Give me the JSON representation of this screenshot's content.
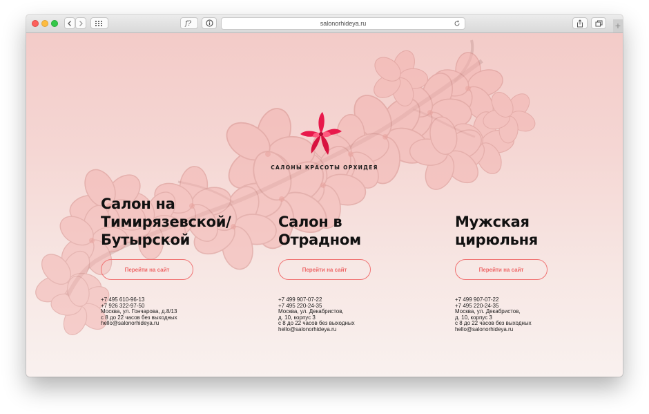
{
  "browser": {
    "url": "salonorhideya.ru",
    "new_tab": "+"
  },
  "brand": {
    "name": "САЛОНЫ КРАСОТЫ ОРХИДЕЯ",
    "accent_color": "#ee6767",
    "logo_icon": "orchid-logo-icon"
  },
  "salons": [
    {
      "title_lines": [
        "Салон на",
        "Тимирязевской/",
        "Бутырской"
      ],
      "button": "Перейти на сайт",
      "info": [
        "+7 495 610-96-13",
        "+7 926 322-97-50",
        "Москва, ул. Гончарова, д.8/13",
        "с 8 до 22 часов без выходных",
        "hello@salonorhideya.ru"
      ]
    },
    {
      "title_lines": [
        "Салон в",
        "Отрадном"
      ],
      "button": "Перейти на сайт",
      "info": [
        "+7 499 907-07-22",
        "+7 495 220-24-35",
        "Москва, ул. Декабристов,",
        "д. 10, корпус 3",
        "с 8 до 22 часов без выходных",
        "hello@salonorhideya.ru"
      ]
    },
    {
      "title_lines": [
        "Мужская",
        "цирюльня"
      ],
      "button": "Перейти на сайт",
      "info": [
        "+7 499 907-07-22",
        "+7 495 220-24-35",
        "Москва, ул. Декабристов,",
        "д. 10, корпус 3",
        "с 8 до 22 часов без выходных",
        "hello@salonorhideya.ru"
      ]
    }
  ]
}
